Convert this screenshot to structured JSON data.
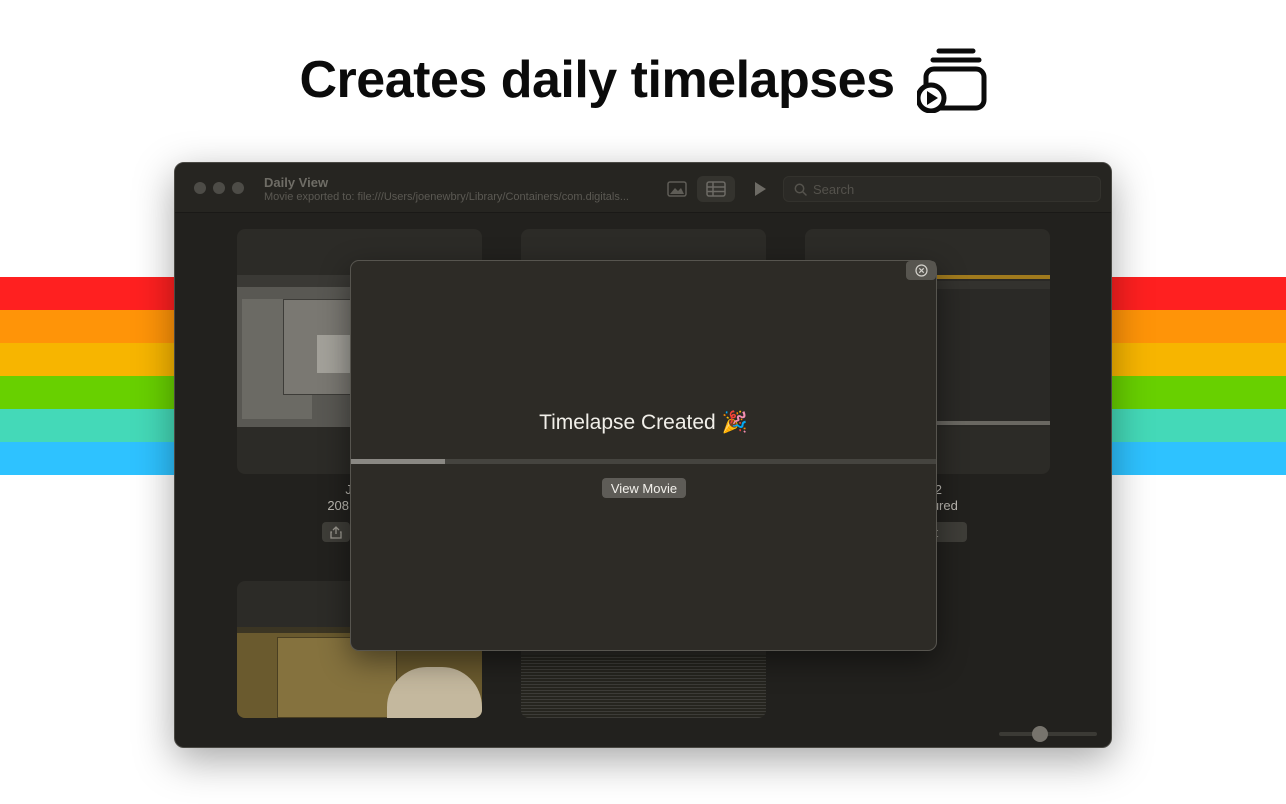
{
  "headline": {
    "text": "Creates daily timelapses",
    "icon": "stacked-cards-play-icon"
  },
  "stripes": [
    "#ff2020",
    "#ff9408",
    "#f7b500",
    "#68d000",
    "#44d9b8",
    "#2ec2ff"
  ],
  "window": {
    "title": "Daily View",
    "subtitle": "Movie exported to: file:///Users/joenewbry/Library/Containers/com.digitals...",
    "toolbar": {
      "icons": [
        "photo-icon",
        "grid-table-icon",
        "play-icon"
      ]
    },
    "search": {
      "placeholder": "Search",
      "value": ""
    }
  },
  "cards": [
    {
      "date": "June",
      "caption": "208 screen",
      "export_label": ""
    },
    {
      "date": "",
      "caption": "",
      "export_label": ""
    },
    {
      "date": "2022",
      "caption": "s captured",
      "export_label": "port"
    },
    {
      "date": "",
      "caption": "",
      "export_label": ""
    },
    {
      "date": "",
      "caption": "",
      "export_label": ""
    }
  ],
  "zoom_slider": {
    "value": 0.4
  },
  "dialog": {
    "title": "Timelapse Created",
    "emoji": "🎉",
    "progress": 0.16,
    "button_label": "View Movie",
    "close_icon": "close-circle-icon"
  }
}
